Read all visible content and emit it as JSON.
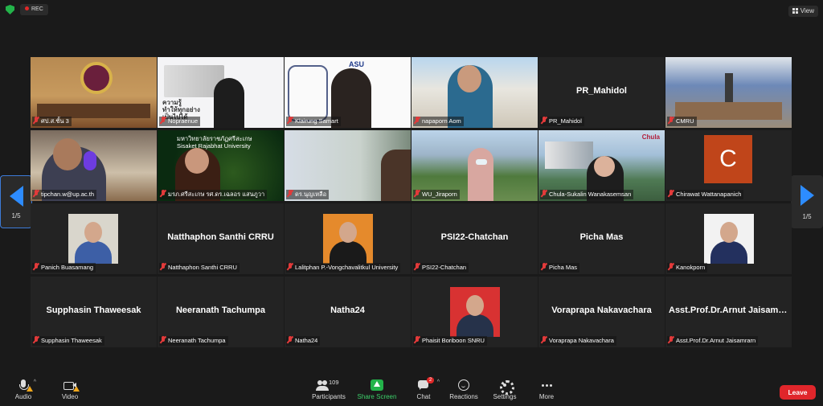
{
  "top": {
    "rec_label": "REC",
    "view_label": "View"
  },
  "gallery": {
    "page_left": "1/5",
    "page_right": "1/5",
    "tiles": [
      {
        "id": "t1",
        "label": "ศป.ส.ชั้น 3"
      },
      {
        "id": "t2",
        "label": "Nopraenue",
        "text": "ความรู้\nทำให้ทุกอย่าง\nเป็นไปได้"
      },
      {
        "id": "t3",
        "label": "Klairung Samart",
        "text": "ASU"
      },
      {
        "id": "t4",
        "label": "napaporn Aom"
      },
      {
        "id": "t5",
        "label": "PR_Mahidol",
        "bigname": "PR_Mahidol"
      },
      {
        "id": "t6",
        "label": "CMRU"
      },
      {
        "id": "t7",
        "label": "tipchan.w@up.ac.th"
      },
      {
        "id": "t8",
        "label": "มรภ.ศรีสะเกษ รศ.ดร.เฉลอร แสนภูวา",
        "text": "มหาวิทยาลัยราชภัฏศรีสะเกษ\nSisaket Rajabhat University"
      },
      {
        "id": "t9",
        "label": "ดร.นุญเหลือ"
      },
      {
        "id": "t10",
        "label": "WU_Jiraporn"
      },
      {
        "id": "t11",
        "label": "Chula-Sukalin Wanakasemsan",
        "text": "Chula"
      },
      {
        "id": "t12",
        "label": "Chirawat Wattanapanich",
        "avatar": "C"
      },
      {
        "id": "t13",
        "label": "Panich Buasamang"
      },
      {
        "id": "t14",
        "label": "Natthaphon Santhi CRRU",
        "bigname": "Natthaphon Santhi CRRU"
      },
      {
        "id": "t15",
        "label": "Lalitphan P.-Vongchavalitkul University"
      },
      {
        "id": "t16",
        "label": "PSI22-Chatchan",
        "bigname": "PSI22-Chatchan"
      },
      {
        "id": "t17",
        "label": "Picha Mas",
        "bigname": "Picha Mas"
      },
      {
        "id": "t18",
        "label": "Kanokporn"
      },
      {
        "id": "t19",
        "label": "Supphasin Thaweesak",
        "bigname": "Supphasin Thaweesak"
      },
      {
        "id": "t20",
        "label": "Neeranath Tachumpa",
        "bigname": "Neeranath Tachumpa"
      },
      {
        "id": "t21",
        "label": "Natha24",
        "bigname": "Natha24"
      },
      {
        "id": "t22",
        "label": "Phaisit Boriboon SNRU"
      },
      {
        "id": "t23",
        "label": "Voraprapa Nakavachara",
        "bigname": "Voraprapa Nakavachara"
      },
      {
        "id": "t24",
        "label": "Asst.Prof.Dr.Arnut Jaisamrarn",
        "bigname": "Asst.Prof.Dr.Arnut Jaisamrarn"
      }
    ]
  },
  "toolbar": {
    "audio": "Audio",
    "video": "Video",
    "participants": "Participants",
    "participants_count": "109",
    "share": "Share Screen",
    "chat": "Chat",
    "chat_badge": "2",
    "reactions": "Reactions",
    "settings": "Settings",
    "more": "More",
    "leave": "Leave"
  },
  "colors": {
    "active_border": "#c5e25a",
    "share_green": "#23b34a",
    "leave_red": "#e0262b",
    "nav_blue": "#2d8cff"
  }
}
